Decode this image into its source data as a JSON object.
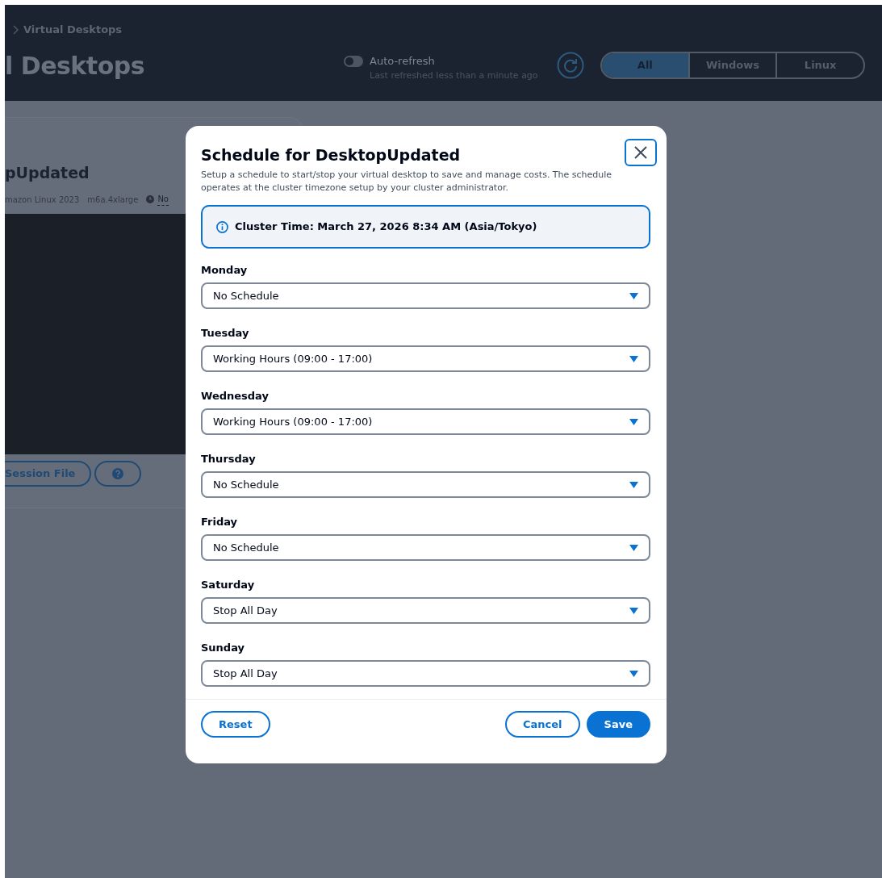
{
  "header": {
    "breadcrumb": "Virtual Desktops",
    "title": "l Desktops",
    "auto_refresh": {
      "label": "Auto-refresh",
      "on": false,
      "note": "Last refreshed less than a minute ago"
    },
    "filters": [
      {
        "label": "All",
        "selected": true
      },
      {
        "label": "Windows",
        "selected": false
      },
      {
        "label": "Linux",
        "selected": false
      }
    ]
  },
  "card": {
    "title": "pUpdated",
    "meta": [
      "mazon Linux 2023",
      "m6a.4xlarge"
    ],
    "schedule_link": "No",
    "buttons": [
      "Session File"
    ]
  },
  "modal": {
    "title": "Schedule for DesktopUpdated",
    "description": "Setup a schedule to start/stop your virtual desktop to save and manage costs. The schedule operates at the cluster timezone setup by your cluster administrator.",
    "cluster_time": "Cluster Time: March 27, 2026 8:34 AM (Asia/Tokyo)",
    "days": [
      {
        "label": "Monday",
        "value": "No Schedule"
      },
      {
        "label": "Tuesday",
        "value": "Working Hours (09:00 - 17:00)"
      },
      {
        "label": "Wednesday",
        "value": "Working Hours (09:00 - 17:00)"
      },
      {
        "label": "Thursday",
        "value": "No Schedule"
      },
      {
        "label": "Friday",
        "value": "No Schedule"
      },
      {
        "label": "Saturday",
        "value": "Stop All Day"
      },
      {
        "label": "Sunday",
        "value": "Stop All Day"
      }
    ],
    "buttons": [
      {
        "label": "Reset",
        "kind": "outline"
      },
      {
        "label": "Cancel",
        "kind": "outline"
      },
      {
        "label": "Save",
        "kind": "primary"
      }
    ]
  }
}
